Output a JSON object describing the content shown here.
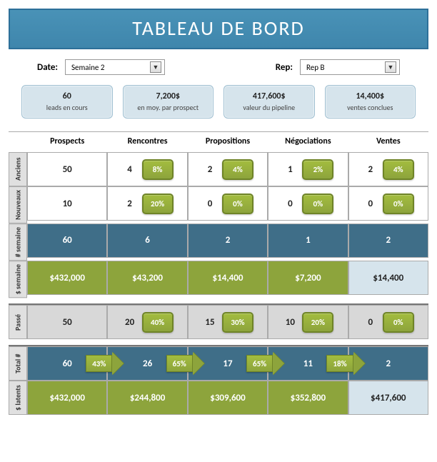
{
  "banner": "TABLEAU DE BORD",
  "controls": {
    "date_label": "Date:",
    "date_value": "Semaine 2",
    "rep_label": "Rep:",
    "rep_value": "Rep B"
  },
  "kpis": [
    {
      "value": "60",
      "label": "leads en cours"
    },
    {
      "value": "7,200$",
      "label": "en moy. par prospect"
    },
    {
      "value": "417,600$",
      "label": "valeur du pipeline"
    },
    {
      "value": "14,400$",
      "label": "ventes conclues"
    }
  ],
  "columns": [
    "Prospects",
    "Rencontres",
    "Propositions",
    "Négociations",
    "Ventes"
  ],
  "section1": {
    "rows": [
      {
        "label": "Anciens",
        "style": "white",
        "cells": [
          {
            "n": "50"
          },
          {
            "n": "4",
            "pct": "8%"
          },
          {
            "n": "2",
            "pct": "4%"
          },
          {
            "n": "1",
            "pct": "2%"
          },
          {
            "n": "2",
            "pct": "4%"
          }
        ]
      },
      {
        "label": "Nouveaux",
        "style": "white",
        "cells": [
          {
            "n": "10"
          },
          {
            "n": "2",
            "pct": "20%"
          },
          {
            "n": "0",
            "pct": "0%"
          },
          {
            "n": "0",
            "pct": "0%"
          },
          {
            "n": "0",
            "pct": "0%"
          }
        ]
      },
      {
        "label": "# semaine",
        "style": "blue",
        "cells": [
          {
            "n": "60"
          },
          {
            "n": "6"
          },
          {
            "n": "2"
          },
          {
            "n": "1"
          },
          {
            "n": "2"
          }
        ]
      },
      {
        "label": "$ semaine",
        "style": "olive",
        "cells": [
          {
            "n": "$432,000"
          },
          {
            "n": "$43,200"
          },
          {
            "n": "$14,400"
          },
          {
            "n": "$7,200"
          },
          {
            "n": "$14,400",
            "alt": "lightblue"
          }
        ]
      }
    ]
  },
  "section2": {
    "rows": [
      {
        "label": "Passé",
        "style": "grey",
        "cells": [
          {
            "n": "50"
          },
          {
            "n": "20",
            "pct": "40%"
          },
          {
            "n": "15",
            "pct": "30%"
          },
          {
            "n": "10",
            "pct": "20%"
          },
          {
            "n": "0",
            "pct": "0%"
          }
        ]
      }
    ]
  },
  "section3": {
    "rows": [
      {
        "label": "Total #",
        "style": "blue",
        "arrows": true,
        "cells": [
          {
            "n": "60",
            "arrow": "43%"
          },
          {
            "n": "26",
            "arrow": "65%"
          },
          {
            "n": "17",
            "arrow": "65%"
          },
          {
            "n": "11",
            "arrow": "18%"
          },
          {
            "n": "2"
          }
        ]
      },
      {
        "label": "$ latents",
        "style": "olive",
        "cells": [
          {
            "n": "$432,000"
          },
          {
            "n": "$244,800"
          },
          {
            "n": "$309,600"
          },
          {
            "n": "$352,800"
          },
          {
            "n": "$417,600",
            "alt": "lightblue"
          }
        ]
      }
    ]
  }
}
